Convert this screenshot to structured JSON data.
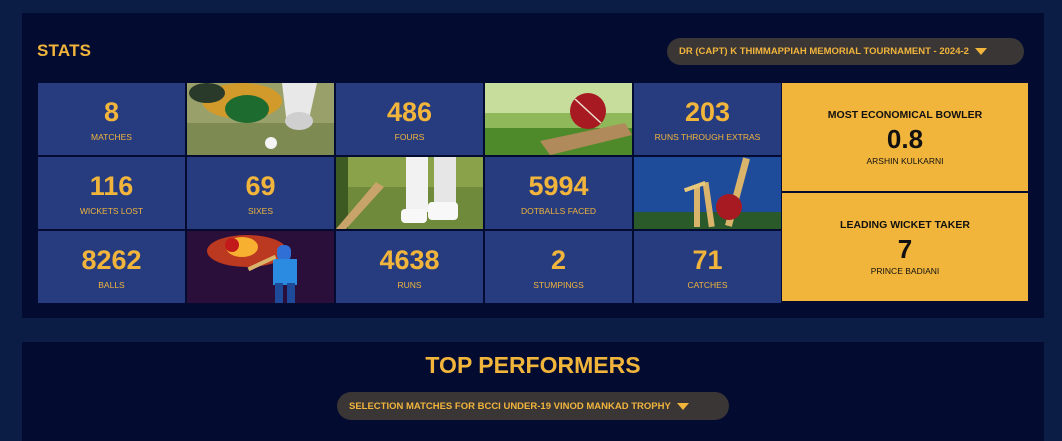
{
  "stats": {
    "title": "STATS",
    "tournament_dropdown": {
      "selected": "DR (CAPT) K THIMMAPPIAH MEMORIAL TOURNAMENT - 2024-2"
    },
    "tiles": [
      {
        "value": "8",
        "label": "MATCHES"
      },
      {
        "value": "486",
        "label": "FOURS"
      },
      {
        "value": "203",
        "label": "RUNS THROUGH EXTRAS"
      },
      {
        "value": "116",
        "label": "WICKETS LOST"
      },
      {
        "value": "69",
        "label": "SIXES"
      },
      {
        "value": "5994",
        "label": "DOTBALLS FACED"
      },
      {
        "value": "8262",
        "label": "BALLS"
      },
      {
        "value": "4638",
        "label": "RUNS"
      },
      {
        "value": "2",
        "label": "STUMPINGS"
      },
      {
        "value": "71",
        "label": "CATCHES"
      }
    ],
    "images": [
      {
        "icon": "wicketkeeper-gloves-image"
      },
      {
        "icon": "cricket-ball-on-bat-image"
      },
      {
        "icon": "batsman-legs-image"
      },
      {
        "icon": "ball-hitting-stumps-image"
      },
      {
        "icon": "fiery-batsman-image"
      }
    ],
    "highlights": [
      {
        "title": "MOST ECONOMICAL BOWLER",
        "value": "0.8",
        "name": "ARSHIN KULKARNI"
      },
      {
        "title": "LEADING WICKET TAKER",
        "value": "7",
        "name": "PRINCE BADIANI"
      }
    ]
  },
  "top_performers": {
    "title": "TOP PERFORMERS",
    "dropdown": {
      "selected": "SELECTION MATCHES FOR BCCI UNDER-19 VINOD MANKAD TROPHY"
    }
  },
  "colors": {
    "accent": "#f2b53c",
    "tile_bg": "#263c7e",
    "panel_bg": "#030c30",
    "page_bg": "#0c1d45"
  }
}
